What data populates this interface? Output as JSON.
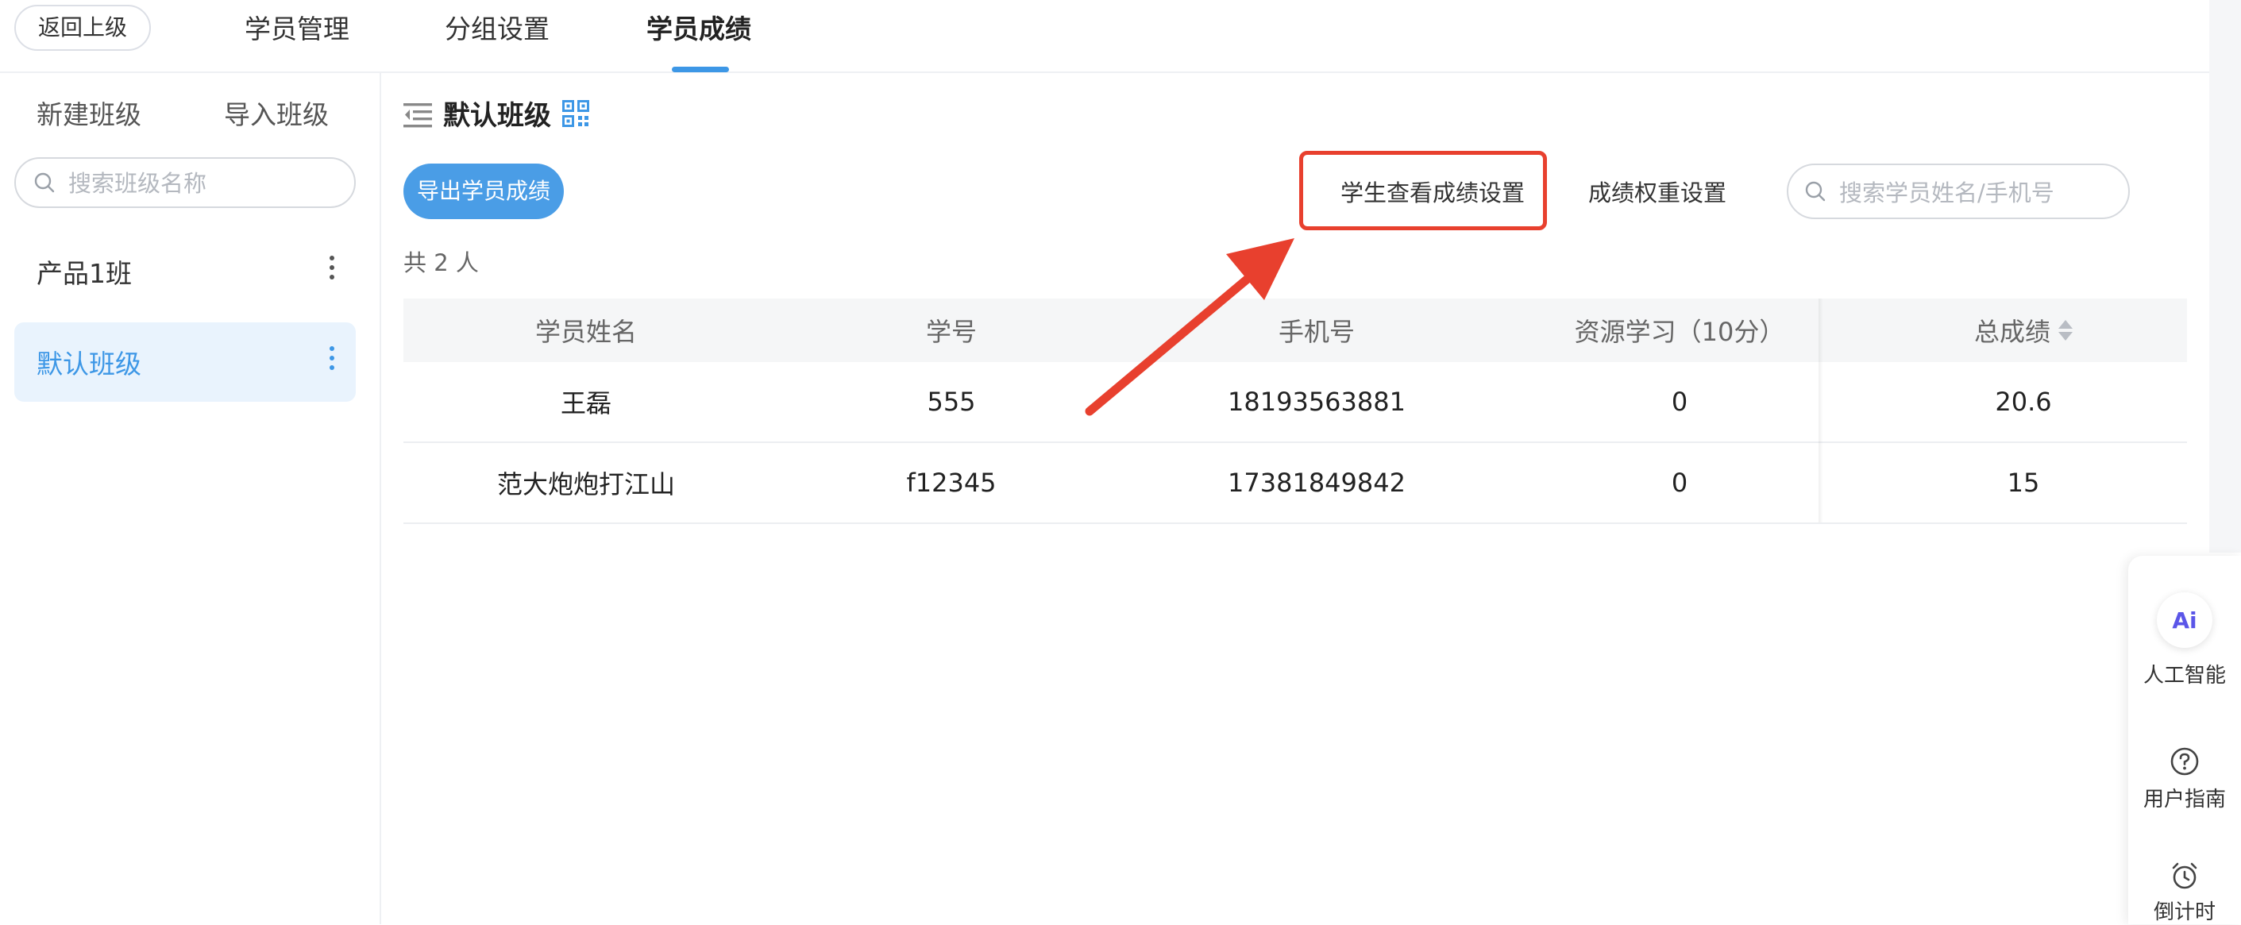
{
  "topbar": {
    "back_label": "返回上级",
    "tabs": [
      {
        "label": "学员管理"
      },
      {
        "label": "分组设置"
      },
      {
        "label": "学员成绩"
      }
    ],
    "active_tab": "学员成绩",
    "accent_color": "#3d97e6"
  },
  "sidebar": {
    "new_class_label": "新建班级",
    "import_class_label": "导入班级",
    "search_placeholder": "搜索班级名称",
    "classes": [
      {
        "label": "产品1班"
      },
      {
        "label": "默认班级"
      }
    ],
    "active_class": "默认班级"
  },
  "main": {
    "title": "默认班级",
    "export_label": "导出学员成绩",
    "view_setting_label": "学生查看成绩设置",
    "weight_setting_label": "成绩权重设置",
    "student_search_placeholder": "搜索学员姓名/手机号",
    "total_text": "共 2 人",
    "highlight_color": "#e8402e"
  },
  "table": {
    "columns": [
      "学员姓名",
      "学号",
      "手机号",
      "资源学习（10分）",
      "总成绩"
    ],
    "rows": [
      {
        "name": "王磊",
        "student_id": "555",
        "phone": "18193563881",
        "resource": "0",
        "total": "20.6"
      },
      {
        "name": "范大炮炮打江山",
        "student_id": "f12345",
        "phone": "17381849842",
        "resource": "0",
        "total": "15"
      }
    ]
  },
  "float_tools": {
    "ai_badge": "Ai",
    "ai_label": "人工智能",
    "guide_label": "用户指南",
    "timer_label": "倒计时"
  }
}
